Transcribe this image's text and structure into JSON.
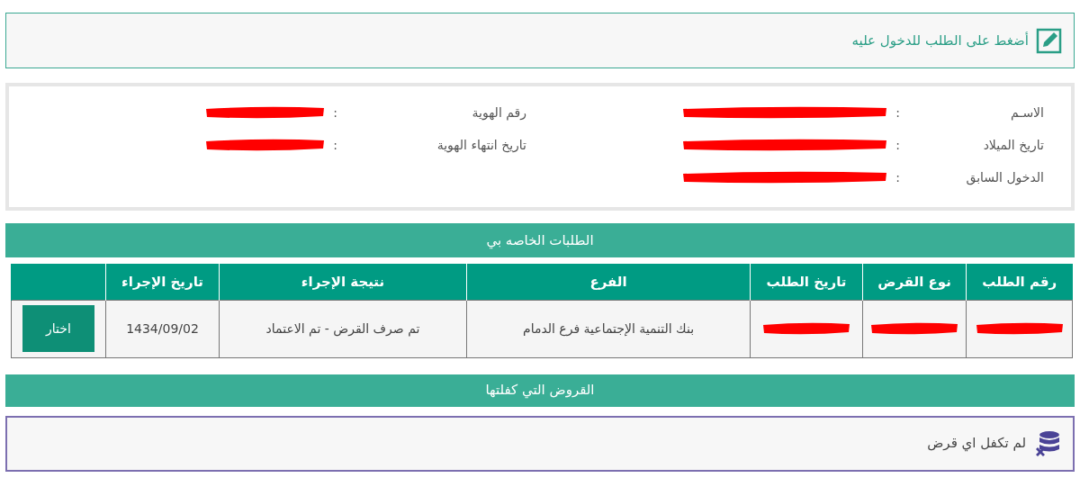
{
  "hint": {
    "text": "أضغط على الطلب للدخول عليه"
  },
  "profile": {
    "fields": [
      {
        "label": "الاسـم",
        "colon": ":",
        "redacted": true
      },
      {
        "label": "رقم الهوية",
        "colon": ":",
        "redacted": true
      },
      {
        "label": "تاريخ الميلاد",
        "colon": ":",
        "redacted": true
      },
      {
        "label": "تاريخ انتهاء الهوية",
        "colon": ":",
        "redacted": true
      },
      {
        "label": "الدخول السابق",
        "colon": ":",
        "redacted": true
      }
    ]
  },
  "requests": {
    "title": "الطلبات الخاصه بي",
    "columns": [
      "رقم الطلب",
      "نوع القرض",
      "تاريخ الطلب",
      "الفرع",
      "نتيجة الإجراء",
      "تاريخ الإجراء"
    ],
    "rows": [
      {
        "cells": [
          {
            "redacted": true
          },
          {
            "redacted": true
          },
          {
            "redacted": true
          },
          {
            "text": "بنك التنمية الإجتماعية فرع الدمام"
          },
          {
            "text": "تم صرف القرض - تم الاعتماد"
          },
          {
            "text": "1434/09/02"
          }
        ],
        "button": "اختار"
      }
    ]
  },
  "guarantees": {
    "title": "القروض التي كفلتها",
    "empty_message": "لم تكفل اي قرض"
  }
}
